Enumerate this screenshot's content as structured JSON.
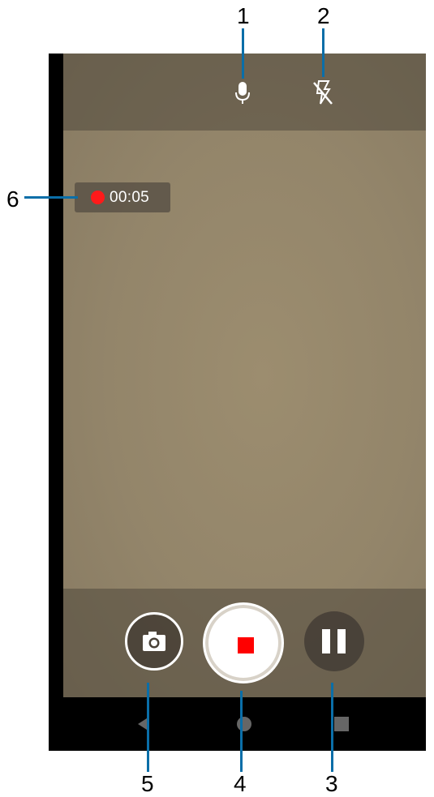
{
  "callouts": [
    "1",
    "2",
    "3",
    "4",
    "5",
    "6"
  ],
  "timer": {
    "text": "00:05",
    "dot_color": "#ff1a1a"
  },
  "top_bar": {
    "mic_icon": "microphone-icon",
    "flash_icon": "flash-off-icon"
  },
  "bottom_bar": {
    "snapshot_icon": "camera-icon",
    "stop_icon": "stop-record-icon",
    "pause_icon": "pause-icon"
  },
  "nav": [
    "back-icon",
    "home-icon",
    "recents-icon"
  ],
  "colors": {
    "callout_line": "#0a6ea8",
    "record": "#ff0000"
  }
}
